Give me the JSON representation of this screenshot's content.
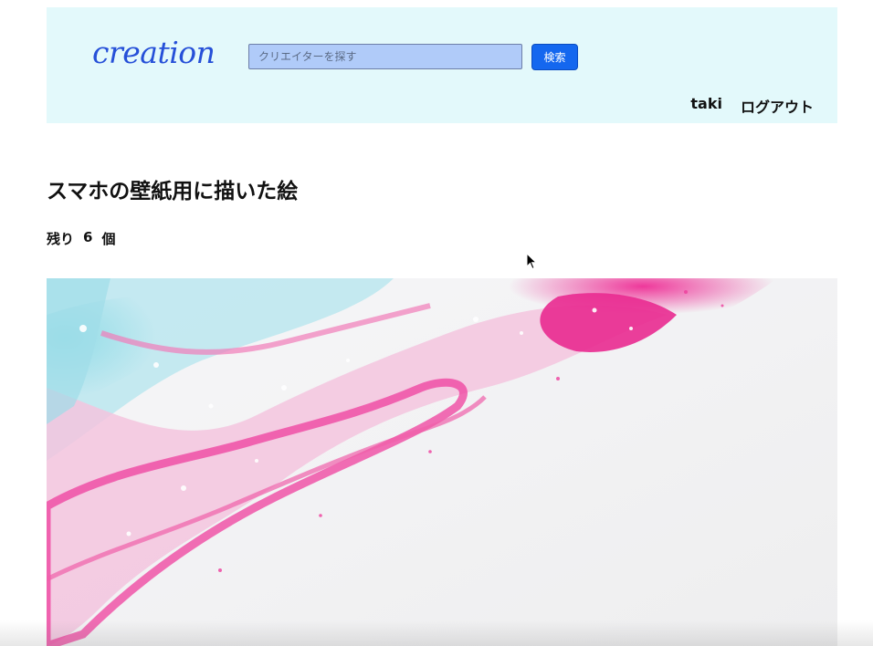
{
  "header": {
    "logo": "creation",
    "search": {
      "placeholder": "クリエイターを探す",
      "value": "",
      "button_label": "検索"
    },
    "user_nav": {
      "username": "taki",
      "logout_label": "ログアウト"
    }
  },
  "main": {
    "title": "スマホの壁紙用に描いた絵",
    "remaining": {
      "prefix": "残り",
      "count": "6",
      "unit": "個"
    }
  },
  "colors": {
    "header_bg": "#e3f9fb",
    "logo": "#2650d8",
    "search_input_bg": "#b0cbf9",
    "search_button": "#1467ef",
    "art_pink": "#ee3d9c",
    "art_cyan": "#8fdbe6"
  },
  "icons": {
    "cursor": "mouse-pointer-icon"
  }
}
